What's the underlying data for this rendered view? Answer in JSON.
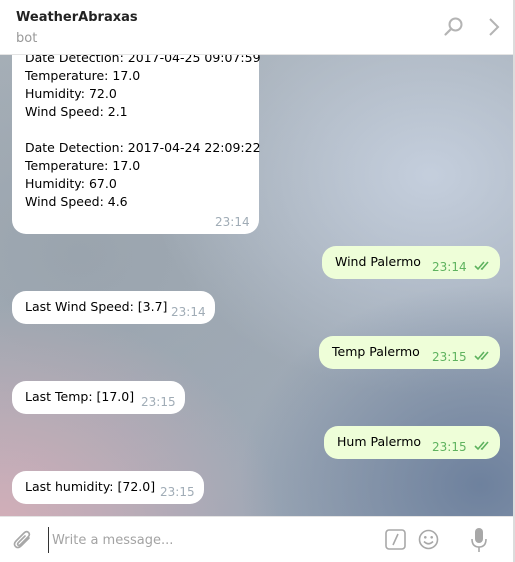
{
  "header": {
    "chat_name": "WeatherAbraxas",
    "chat_subtitle": "bot"
  },
  "messages": [
    {
      "direction": "in",
      "lines": [
        "Date Detection: 2017-04-25 09:07:59",
        "Temperature: 17.0",
        "Humidity: 72.0",
        "Wind Speed: 2.1",
        "",
        "Date Detection: 2017-04-24 22:09:22",
        "Temperature: 17.0",
        "Humidity: 67.0",
        "Wind Speed: 4.6"
      ],
      "time": "23:14"
    },
    {
      "direction": "out",
      "text": "Wind Palermo",
      "time": "23:14",
      "read": true
    },
    {
      "direction": "in",
      "text": "Last Wind Speed: [3.7]",
      "time": "23:14"
    },
    {
      "direction": "out",
      "text": "Temp Palermo",
      "time": "23:15",
      "read": true
    },
    {
      "direction": "in",
      "text": "Last Temp: [17.0]",
      "time": "23:15"
    },
    {
      "direction": "out",
      "text": "Hum Palermo",
      "time": "23:15",
      "read": true
    },
    {
      "direction": "in",
      "text": "Last humidity: [72.0]",
      "time": "23:15"
    }
  ],
  "composer": {
    "placeholder": "Write a message...",
    "value": ""
  },
  "icons": {
    "search": "search-icon",
    "more": "chevron-right-icon",
    "attach": "paperclip-icon",
    "commands": "slash-commands-icon",
    "emoji": "emoji-icon",
    "mic": "microphone-icon"
  },
  "colors": {
    "outgoing_bubble": "#eefed8",
    "incoming_bubble": "#ffffff",
    "read_check": "#5fb35f",
    "time_incoming": "#a0acb6"
  }
}
